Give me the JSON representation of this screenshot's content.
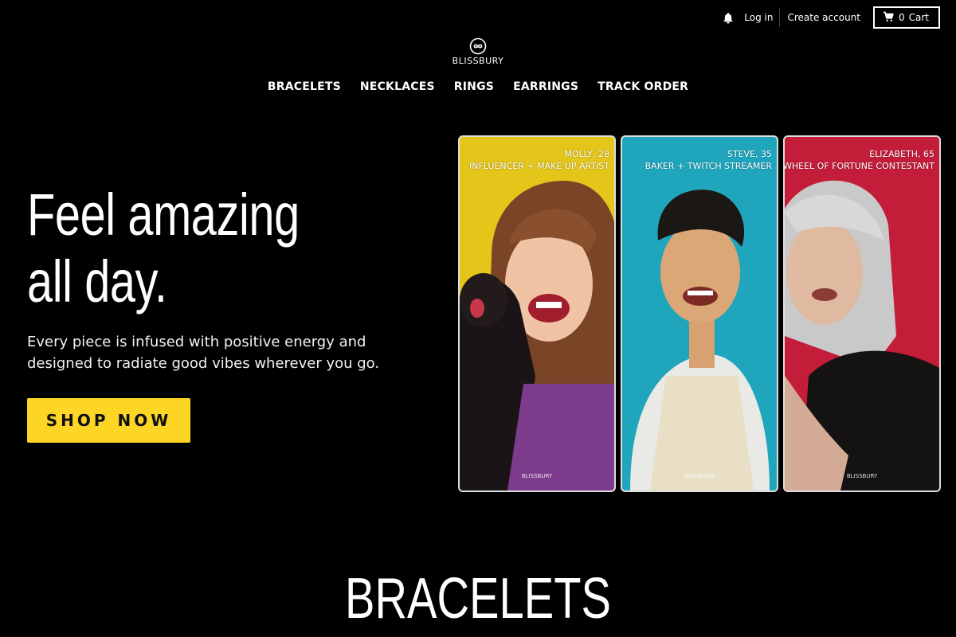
{
  "utility": {
    "login": "Log in",
    "create_account": "Create account",
    "cart_count": "0",
    "cart_label": "Cart"
  },
  "logo": {
    "wordmark": "BLISSBURY"
  },
  "nav": [
    "BRACELETS",
    "NECKLACES",
    "RINGS",
    "EARRINGS",
    "TRACK ORDER"
  ],
  "hero": {
    "title": "Feel amazing all day.",
    "subtitle": "Every piece is infused with positive energy and designed to radiate good vibes wherever you go.",
    "cta": "SHOP NOW"
  },
  "cards": [
    {
      "name": "MOLLY, 28",
      "role": "INFLUENCER + MAKE UP ARTIST",
      "bg": "#e4c51a",
      "brand": "BLISSBURY"
    },
    {
      "name": "STEVE, 35",
      "role": "BAKER + TWITCH STREAMER",
      "bg": "#1fa6bd",
      "brand": "BLISSBURY"
    },
    {
      "name": "ELIZABETH, 65",
      "role": "WHEEL OF FORTUNE CONTESTANT",
      "bg": "#c41d3a",
      "brand": "BLISSBURY"
    }
  ],
  "section": {
    "title": "BRACELETS"
  },
  "colors": {
    "accent": "#fdd525",
    "background": "#000000"
  },
  "icons": {
    "notification": "bell-icon",
    "cart": "cart-icon",
    "logo": "infinity-circle-icon"
  }
}
